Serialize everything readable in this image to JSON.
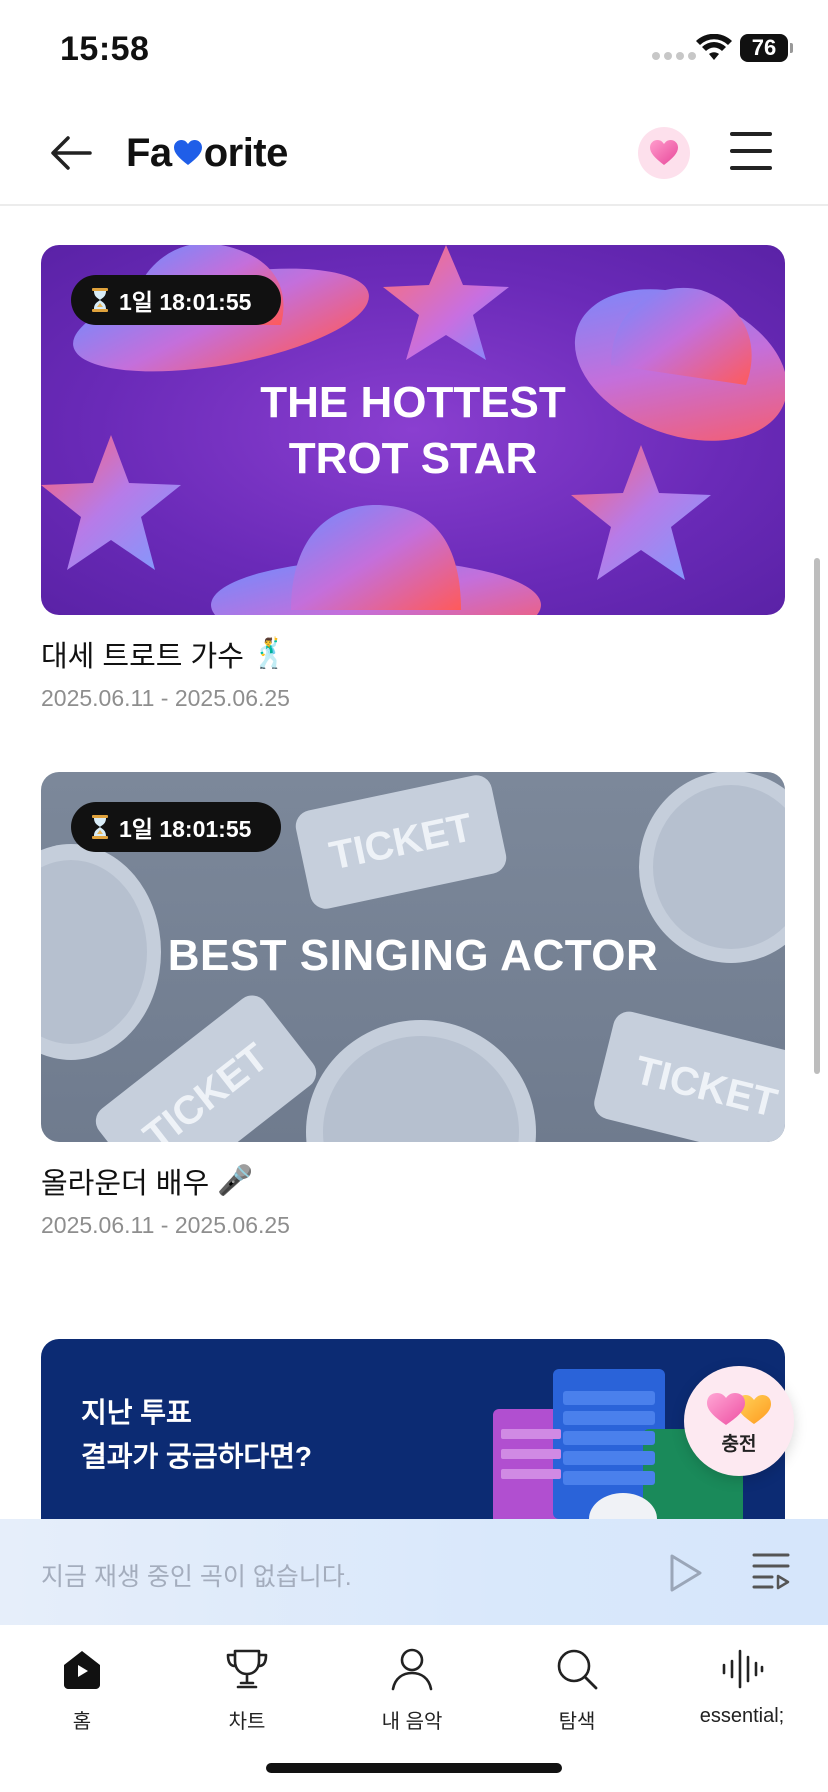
{
  "status_bar": {
    "time": "15:58",
    "battery": "76"
  },
  "header": {
    "logo_prefix": "Fa",
    "logo_suffix": "orite"
  },
  "cards": [
    {
      "timer": "1일 18:01:55",
      "headline_line1": "THE HOTTEST",
      "headline_line2": "TROT STAR",
      "title": "대세 트로트 가수",
      "title_emoji": "🕺",
      "date": "2025.06.11 - 2025.06.25"
    },
    {
      "timer": "1일 18:01:55",
      "headline_line1": "BEST SINGING ACTOR",
      "title": "올라운더 배우",
      "title_emoji": "🎤",
      "date": "2025.06.11 - 2025.06.25",
      "ticket_text": "TICKET"
    }
  ],
  "past_results": {
    "line1": "지난 투표",
    "line2": "결과가 궁금하다면?"
  },
  "charge_button": {
    "label": "충전"
  },
  "player": {
    "now_playing": "지금 재생 중인 곡이 없습니다."
  },
  "nav": [
    {
      "label": "홈",
      "icon": "home-icon"
    },
    {
      "label": "차트",
      "icon": "trophy-icon"
    },
    {
      "label": "내 음악",
      "icon": "person-icon"
    },
    {
      "label": "탐색",
      "icon": "search-icon"
    },
    {
      "label": "essential;",
      "icon": "soundwave-icon"
    }
  ],
  "colors": {
    "accent_pink": "#f06aa8",
    "heart_blue": "#1f5ee8",
    "banner_navy": "#0c2b73",
    "banner_purple": "#6a2ab8",
    "banner_gray": "#737f92"
  }
}
